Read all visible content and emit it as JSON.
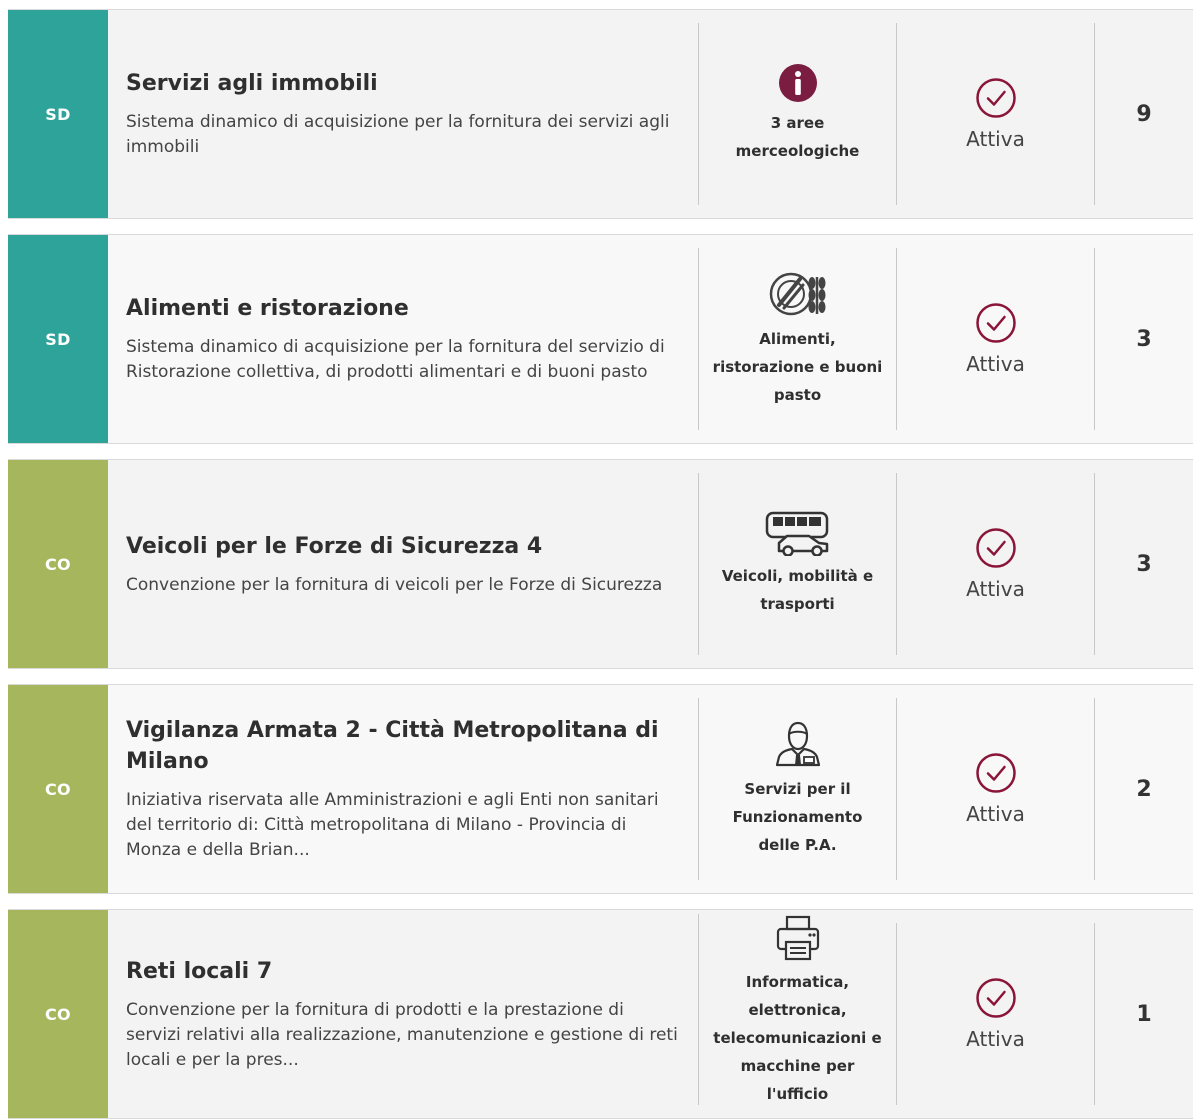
{
  "status_color": "#8a1538",
  "items": [
    {
      "type": "SD",
      "title": "Servizi agli immobili",
      "description": "Sistema dinamico di acquisizione per la fornitura dei servizi agli immobili",
      "category_icon": "info-icon",
      "category_label": "3 aree merceologiche",
      "status": "Attiva",
      "count": "9"
    },
    {
      "type": "SD",
      "title": "Alimenti e ristorazione",
      "description": "Sistema dinamico di acquisizione per la fornitura del servizio di Ristorazione collettiva, di prodotti alimentari e di buoni pasto",
      "category_icon": "food-plate-icon",
      "category_label": "Alimenti, ristorazione e buoni pasto",
      "status": "Attiva",
      "count": "3"
    },
    {
      "type": "CO",
      "title": "Veicoli per le Forze di Sicurezza 4",
      "description": "Convenzione per la fornitura di veicoli per le Forze di Sicurezza",
      "category_icon": "bus-car-icon",
      "category_label": "Veicoli, mobilità e trasporti",
      "status": "Attiva",
      "count": "3"
    },
    {
      "type": "CO",
      "title": "Vigilanza Armata 2 - Città Metropolitana di Milano",
      "description": "Iniziativa riservata alle Amministrazioni e agli Enti non sanitari del territorio di: Città metropolitana di Milano - Provincia di Monza e della Brian...",
      "category_icon": "person-icon",
      "category_label": "Servizi per il Funzionamento delle P.A.",
      "status": "Attiva",
      "count": "2"
    },
    {
      "type": "CO",
      "title": "Reti locali 7",
      "description": "Convenzione per la fornitura di prodotti e la prestazione di servizi relativi alla realizzazione, manutenzione e gestione di reti locali e per la pres...",
      "category_icon": "printer-icon",
      "category_label": "Informatica, elettronica, telecomunicazioni e macchine per l'ufficio",
      "status": "Attiva",
      "count": "1"
    }
  ]
}
